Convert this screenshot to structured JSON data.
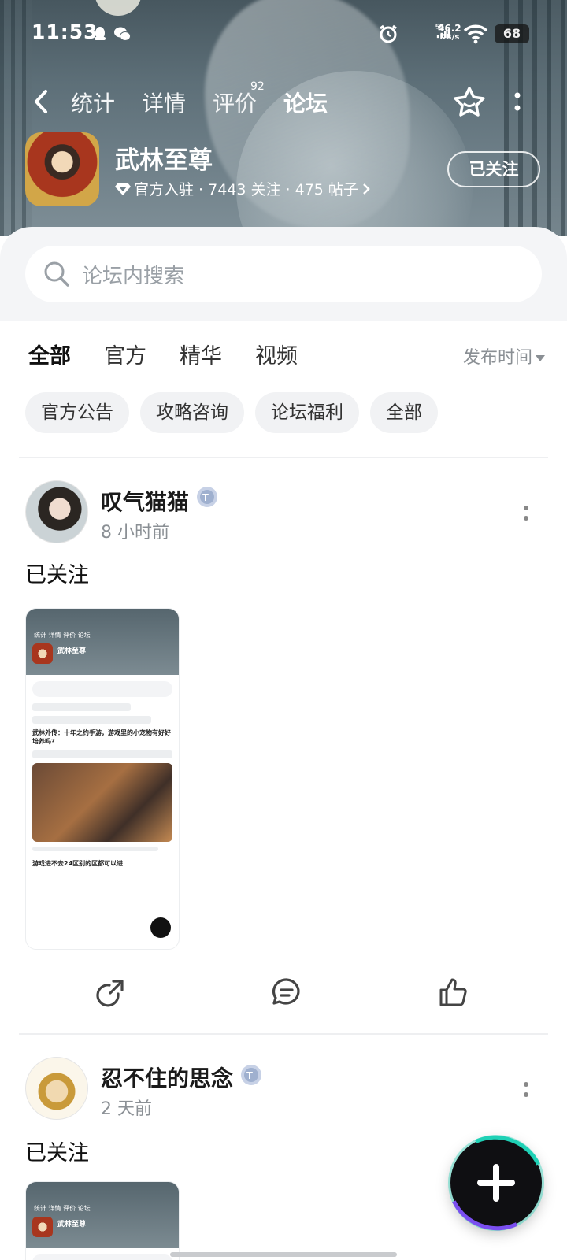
{
  "status_bar": {
    "time": "11:53",
    "net_speed": "46.2",
    "net_unit": "KB/s",
    "signal": "5G",
    "battery": "68"
  },
  "nav": {
    "tabs": [
      {
        "label": "统计"
      },
      {
        "label": "详情"
      },
      {
        "label": "评价"
      },
      {
        "label": "论坛"
      }
    ],
    "review_count": "92",
    "active_tab": "论坛"
  },
  "game": {
    "title": "武林至尊",
    "meta": "官方入驻 · 7443 关注 · 475 帖子",
    "follow_label": "已关注"
  },
  "search": {
    "placeholder": "论坛内搜索"
  },
  "filters": {
    "tabs": [
      "全部",
      "官方",
      "精华",
      "视频"
    ],
    "sort_label": "发布时间",
    "chips": [
      "官方公告",
      "攻略咨询",
      "论坛福利",
      "全部"
    ]
  },
  "posts": [
    {
      "author": "叹气猫猫",
      "time": "8 小时前",
      "text": "已关注",
      "thumb": {
        "nav": "统计  详情  评价  论坛",
        "title": "武林至尊",
        "post_title": "武林外传：十年之约手游，游戏里的小宠物有好好培养吗?",
        "post2_title": "游戏进不去24区别的区都可以进"
      }
    },
    {
      "author": "忍不住的思念",
      "time": "2 天前",
      "text": "已关注",
      "thumb": {
        "nav": "统计  详情  评价  论坛",
        "title": "武林至尊"
      }
    }
  ],
  "colors": {
    "accent": "#1fd1b6",
    "hero_top": "#47575f",
    "chip_bg": "#f1f2f4"
  }
}
